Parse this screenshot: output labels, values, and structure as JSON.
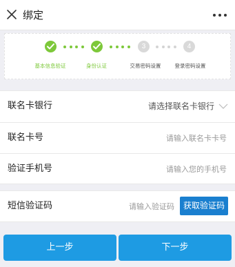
{
  "titlebar": {
    "title": "绑定",
    "close_icon": "close-icon",
    "more_icon": "more-icon"
  },
  "steps": [
    {
      "label": "基本信息验证",
      "status": "done",
      "number": ""
    },
    {
      "label": "身份认证",
      "status": "done",
      "number": ""
    },
    {
      "label": "交易密码设置",
      "status": "todo",
      "number": "3"
    },
    {
      "label": "登录密码设置",
      "status": "todo",
      "number": "4"
    }
  ],
  "form": {
    "bank": {
      "label": "联名卡银行",
      "value": "请选择联名卡银行"
    },
    "card_no": {
      "label": "联名卡号",
      "placeholder": "请输入联名卡卡号"
    },
    "phone": {
      "label": "验证手机号",
      "placeholder": "请输入您的手机号"
    }
  },
  "sms": {
    "label": "短信验证码",
    "placeholder": "请输入验证码",
    "button": "获取验证码"
  },
  "actions": {
    "prev": "上一步",
    "next": "下一步"
  },
  "colors": {
    "accent_green": "#7dc83a",
    "button_blue": "#1e9be3",
    "code_button_blue": "#1a7fcf"
  }
}
